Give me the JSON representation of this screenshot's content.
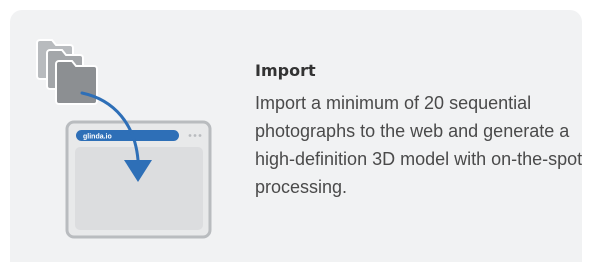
{
  "feature": {
    "title": "Import",
    "description": "Import a minimum of 20 sequential photographs to the web and generate a high-definition 3D model with on-the-spot processing."
  },
  "browser": {
    "url_label": "glinda.io"
  },
  "icons": {
    "folders": "folder-stack-icon",
    "arrow": "curved-arrow-down-icon",
    "menu": "more-dots-icon"
  },
  "colors": {
    "accent": "#2e6fb7",
    "folder_gray": "#8c8f92",
    "card_background": "#f1f2f3"
  }
}
